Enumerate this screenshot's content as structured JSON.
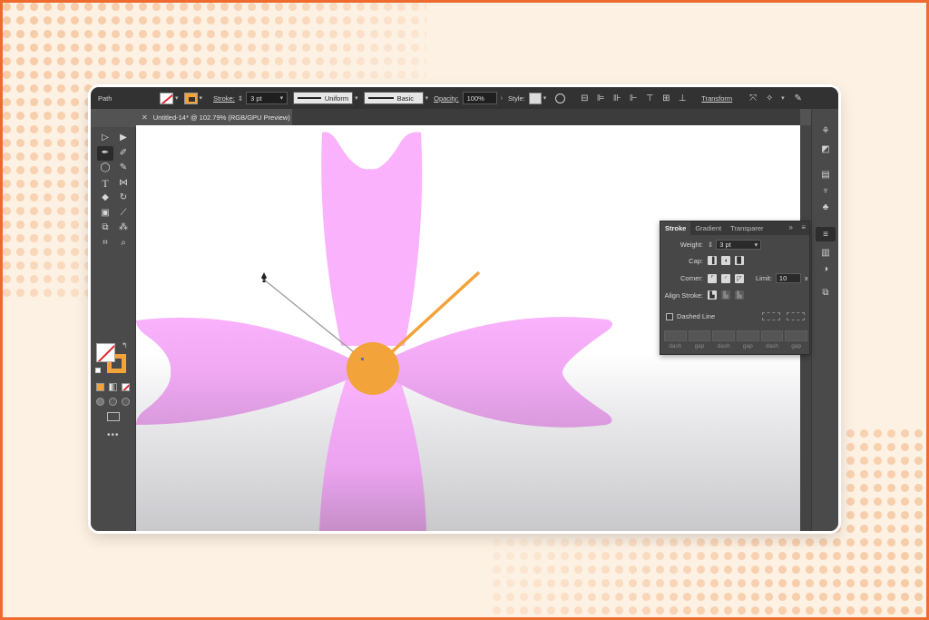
{
  "colors": {
    "frame": "#ef6a2e",
    "background": "#fdf1e3",
    "petal_light": "#f9b2fb",
    "petal_dark": "#c58fc7",
    "center": "#f2a33a",
    "stroke_handle": "#f2a33a"
  },
  "control_bar": {
    "selection_label": "Path",
    "stroke_label": "Stroke:",
    "stroke_weight": "3 pt",
    "profile_uniform": "Uniform",
    "brush_basic": "Basic",
    "opacity_label": "Opacity:",
    "opacity_value": "100%",
    "style_label": "Style:",
    "transform_label": "Transform"
  },
  "document": {
    "tab_title": "Untitled-14* @ 102.79% (RGB/GPU Preview)",
    "close_glyph": "✕"
  },
  "tools": {
    "icons": [
      "selection-icon",
      "direct-selection-icon",
      "pen-icon",
      "curvature-icon",
      "ellipse-icon",
      "paintbrush-icon",
      "type-icon",
      "width-icon",
      "eraser-icon",
      "rotate-icon",
      "gradient-icon",
      "eyedropper-icon",
      "blend-icon",
      "symbol-sprayer-icon",
      "artboard-icon",
      "zoom-icon"
    ],
    "more": "•••"
  },
  "stroke_panel": {
    "tabs": [
      "Stroke",
      "Gradient",
      "Transparer"
    ],
    "weight_label": "Weight:",
    "weight_value": "3 pt",
    "cap_label": "Cap:",
    "corner_label": "Corner:",
    "limit_label": "Limit:",
    "limit_value": "10",
    "limit_unit": "x",
    "align_label": "Align Stroke:",
    "dashed_label": "Dashed Line",
    "dash_labels": [
      "dash",
      "gap",
      "dash",
      "gap",
      "dash",
      "gap"
    ]
  }
}
